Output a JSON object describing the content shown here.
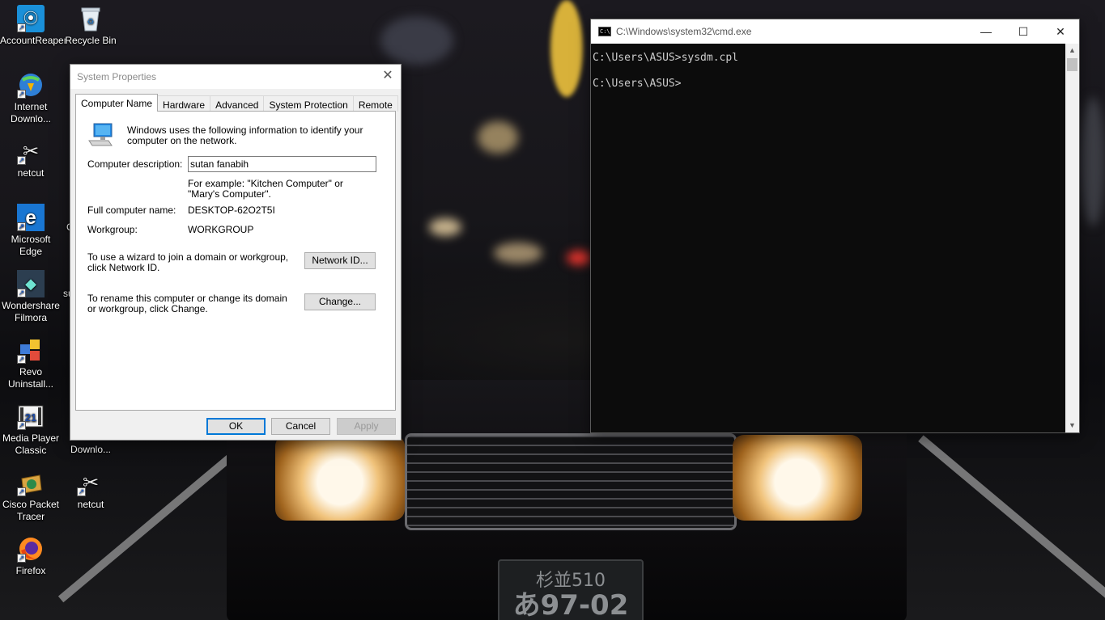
{
  "desktop": {
    "icons": [
      {
        "label": "AccountReaper",
        "icon": "accountreaper-icon"
      },
      {
        "label": "Recycle Bin",
        "icon": "recycle-bin-icon"
      },
      {
        "label": "Internet Downlo...",
        "icon": "internet-download-manager-icon"
      },
      {
        "label": "netcut",
        "icon": "netcut-icon"
      },
      {
        "label": "Microsoft Edge",
        "icon": "edge-icon"
      },
      {
        "label": "Wondershare Filmora",
        "icon": "filmora-icon"
      },
      {
        "label": "Revo Uninstall...",
        "icon": "revo-uninstaller-icon"
      },
      {
        "label": "Media Player Classic",
        "icon": "media-player-classic-icon"
      },
      {
        "label": "Downlo...",
        "icon": "download-icon"
      },
      {
        "label": "Cisco Packet Tracer",
        "icon": "cisco-packet-tracer-icon"
      },
      {
        "label": "netcut",
        "icon": "netcut-icon"
      },
      {
        "label": "Firefox",
        "icon": "firefox-icon"
      }
    ],
    "partial_labels": [
      "C",
      "su"
    ]
  },
  "wallpaper": {
    "plate_line1": "杉並510",
    "plate_line2": "あ97-02"
  },
  "system_properties": {
    "title": "System Properties",
    "tabs": [
      {
        "label": "Computer Name",
        "active": true
      },
      {
        "label": "Hardware",
        "active": false
      },
      {
        "label": "Advanced",
        "active": false
      },
      {
        "label": "System Protection",
        "active": false
      },
      {
        "label": "Remote",
        "active": false
      }
    ],
    "intro": "Windows uses the following information to identify your computer on the network.",
    "description_label": "Computer description:",
    "description_value": "sutan fanabih",
    "example_text": "For example: \"Kitchen Computer\" or \"Mary's Computer\".",
    "full_name_label": "Full computer name:",
    "full_name_value": "DESKTOP-62O2T5I",
    "workgroup_label": "Workgroup:",
    "workgroup_value": "WORKGROUP",
    "network_id_text": "To use a wizard to join a domain or workgroup, click Network ID.",
    "network_id_button": "Network ID...",
    "change_text": "To rename this computer or change its domain or workgroup, click Change.",
    "change_button": "Change...",
    "ok_button": "OK",
    "cancel_button": "Cancel",
    "apply_button": "Apply"
  },
  "cmd": {
    "title": "C:\\Windows\\system32\\cmd.exe",
    "icon_text": "C:\\",
    "lines": [
      "C:\\Users\\ASUS>sysdm.cpl",
      "",
      "C:\\Users\\ASUS>"
    ],
    "controls": {
      "minimize": "—",
      "maximize": "☐",
      "close": "✕"
    }
  },
  "colors": {
    "accent": "#0078d7",
    "console_bg": "#0c0c0c",
    "console_text": "#cccccc",
    "dialog_bg": "#f0f0f0"
  }
}
